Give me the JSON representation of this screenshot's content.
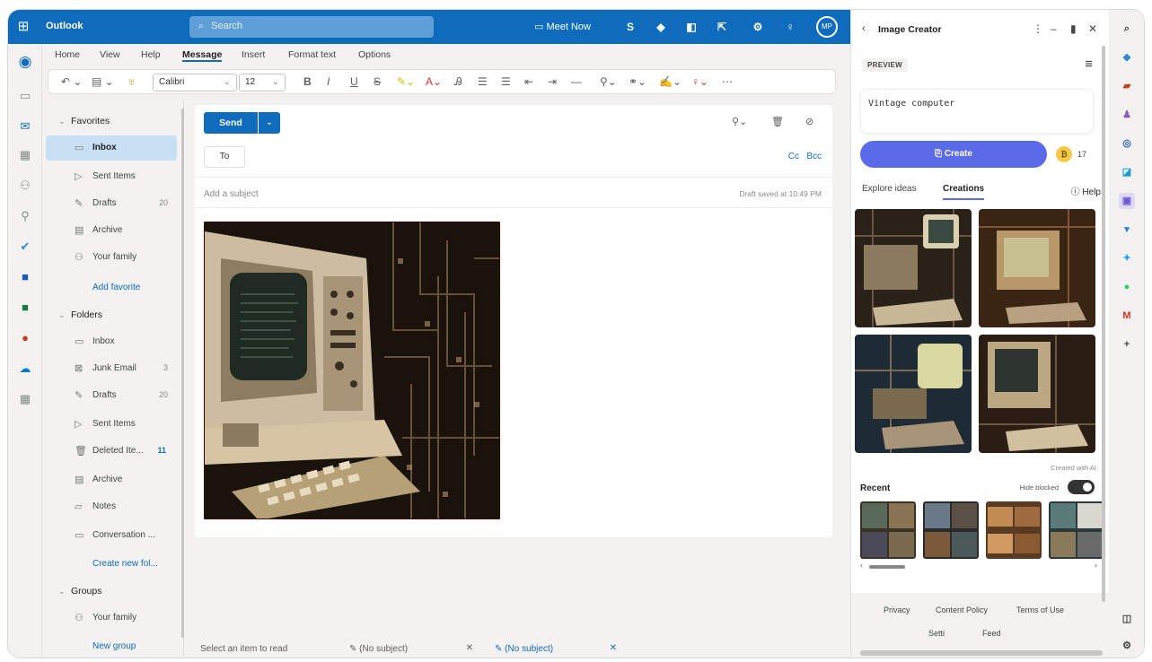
{
  "topbar": {
    "app_name": "Outlook",
    "search_placeholder": "Search",
    "meet_now": "Meet Now",
    "avatar_initials": "MP"
  },
  "ribbon": {
    "tabs": [
      "Home",
      "View",
      "Help",
      "Message",
      "Insert",
      "Format text",
      "Options"
    ],
    "active_tab": "Message",
    "font": "Calibri",
    "size": "12"
  },
  "folders": {
    "favorites_label": "Favorites",
    "favorites": [
      {
        "label": "Inbox",
        "count": "",
        "icon": "inbox-icon"
      },
      {
        "label": "Sent Items",
        "count": "",
        "icon": "send-icon"
      },
      {
        "label": "Drafts",
        "count": "20",
        "icon": "pencil-icon"
      },
      {
        "label": "Archive",
        "count": "",
        "icon": "archive-icon"
      },
      {
        "label": "Your family",
        "count": "",
        "icon": "people-icon"
      }
    ],
    "add_favorite": "Add favorite",
    "folders_label": "Folders",
    "folders": [
      {
        "label": "Inbox",
        "count": "",
        "icon": "inbox-icon"
      },
      {
        "label": "Junk Email",
        "count": "3",
        "icon": "junk-icon"
      },
      {
        "label": "Drafts",
        "count": "20",
        "icon": "pencil-icon"
      },
      {
        "label": "Sent Items",
        "count": "",
        "icon": "send-icon"
      },
      {
        "label": "Deleted Ite...",
        "count": "11",
        "icon": "trash-icon"
      },
      {
        "label": "Archive",
        "count": "",
        "icon": "archive-icon"
      },
      {
        "label": "Notes",
        "count": "",
        "icon": "note-icon"
      },
      {
        "label": "Conversation ...",
        "count": "",
        "icon": "folder-icon"
      }
    ],
    "create_new_folder": "Create new fol...",
    "groups_label": "Groups",
    "groups": [
      {
        "label": "Your family",
        "icon": "people-icon"
      }
    ],
    "new_group": "New group"
  },
  "compose": {
    "send_label": "Send",
    "to_label": "To",
    "cc": "Cc",
    "bcc": "Bcc",
    "subject_placeholder": "Add a subject",
    "draft_status": "Draft saved at 10:49 PM"
  },
  "bottom_tabs": [
    {
      "label": "Select an item to read",
      "closable": false
    },
    {
      "label": "(No subject)",
      "closable": true
    },
    {
      "label": "(No subject)",
      "closable": true,
      "active": true
    }
  ],
  "panel": {
    "title": "Image Creator",
    "badge": "PREVIEW",
    "prompt": "Vintage computer",
    "create_label": "Create",
    "coins": "17",
    "tabs": [
      "Explore ideas",
      "Creations"
    ],
    "active_tab": "Creations",
    "help": "Help",
    "created_with_ai": "Created with AI",
    "recent_label": "Recent",
    "hide_blocked": "Hide blocked",
    "hide_blocked_on": true,
    "footer_links": [
      "Privacy",
      "Content Policy",
      "Terms of Use"
    ],
    "footer_more": [
      "Setti",
      "Feed"
    ]
  },
  "colors": {
    "brand": "#0f6cbd",
    "create_button": "#5a6ae8"
  }
}
